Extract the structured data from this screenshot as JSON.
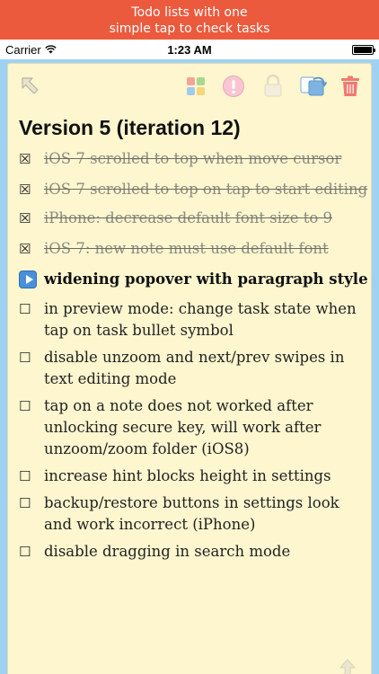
{
  "banner": {
    "line1": "Todo lists with one",
    "line2": "simple tap to check tasks"
  },
  "status_bar": {
    "carrier": "Carrier",
    "time": "1:23 AM"
  },
  "note": {
    "title": "Version 5 (iteration 12)",
    "tasks": [
      {
        "state": "done",
        "bullet": "☒",
        "text": "iOS 7 scrolled to top when move cursor"
      },
      {
        "state": "done",
        "bullet": "☒",
        "text": "iOS 7 scrolled to top on tap to start editing"
      },
      {
        "state": "done",
        "bullet": "☒",
        "text": "iPhone: decrease default font size to 9"
      },
      {
        "state": "done",
        "bullet": "☒",
        "text": "iOS 7: new note must use  default font"
      },
      {
        "state": "in-progress",
        "bullet": "",
        "text": "widening popover with paragraph style"
      },
      {
        "state": "open",
        "bullet": "☐",
        "text": "in preview mode: change task state when tap on task bullet symbol"
      },
      {
        "state": "open",
        "bullet": "☐",
        "text": "disable unzoom and next/prev swipes in text editing mode"
      },
      {
        "state": "open",
        "bullet": "☐",
        "text": "tap on a note does not worked after unlocking secure key, will work after unzoom/zoom folder (iOS8)"
      },
      {
        "state": "open",
        "bullet": "☐",
        "text": "increase hint blocks height in settings"
      },
      {
        "state": "open",
        "bullet": "☐",
        "text": "backup/restore buttons in settings look and work incorrect (iPhone)"
      },
      {
        "state": "open",
        "bullet": "☐",
        "text": "disable dragging in search mode"
      }
    ]
  },
  "toolbar_icons": [
    "back-arrow-icon",
    "grid-icon",
    "alert-icon",
    "lock-icon",
    "move-icon",
    "trash-icon"
  ],
  "colors": {
    "banner": "#ec5a3d",
    "background": "#9fd2f2",
    "note_paper": "#fdf6cf",
    "trash": "#f07a70"
  }
}
